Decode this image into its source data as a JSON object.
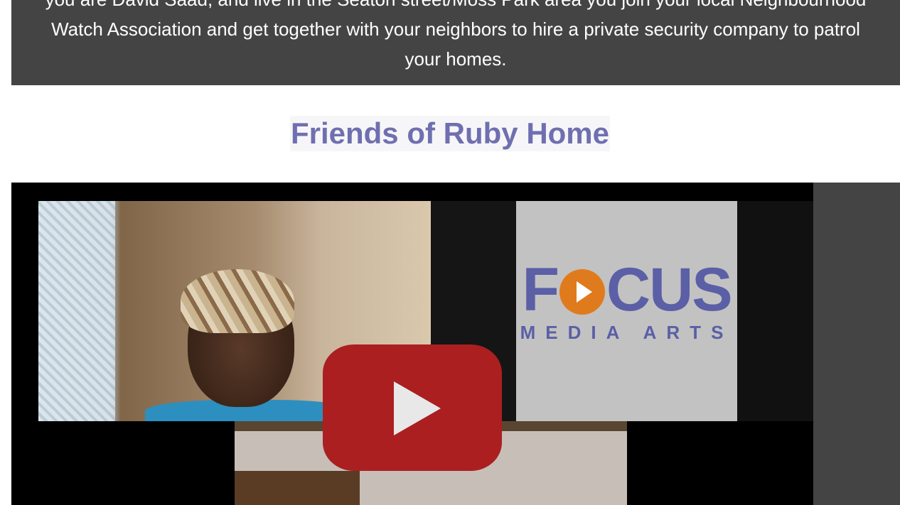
{
  "intro": {
    "text": "you are David Saad, and live in the Seaton street/Moss Park area you join your local Neighbourhood Watch Association and get together with your neighbors to hire a private security company to patrol your homes."
  },
  "section": {
    "title": "Friends of Ruby Home"
  },
  "video": {
    "logo_main_left": "F",
    "logo_main_right": "CUS",
    "logo_sub": "MEDIA ARTS",
    "play_icon": "youtube-play-icon",
    "colors": {
      "play": "#ab1f21",
      "logo": "#5b5fa6",
      "logo_accent": "#e07b1d"
    }
  }
}
